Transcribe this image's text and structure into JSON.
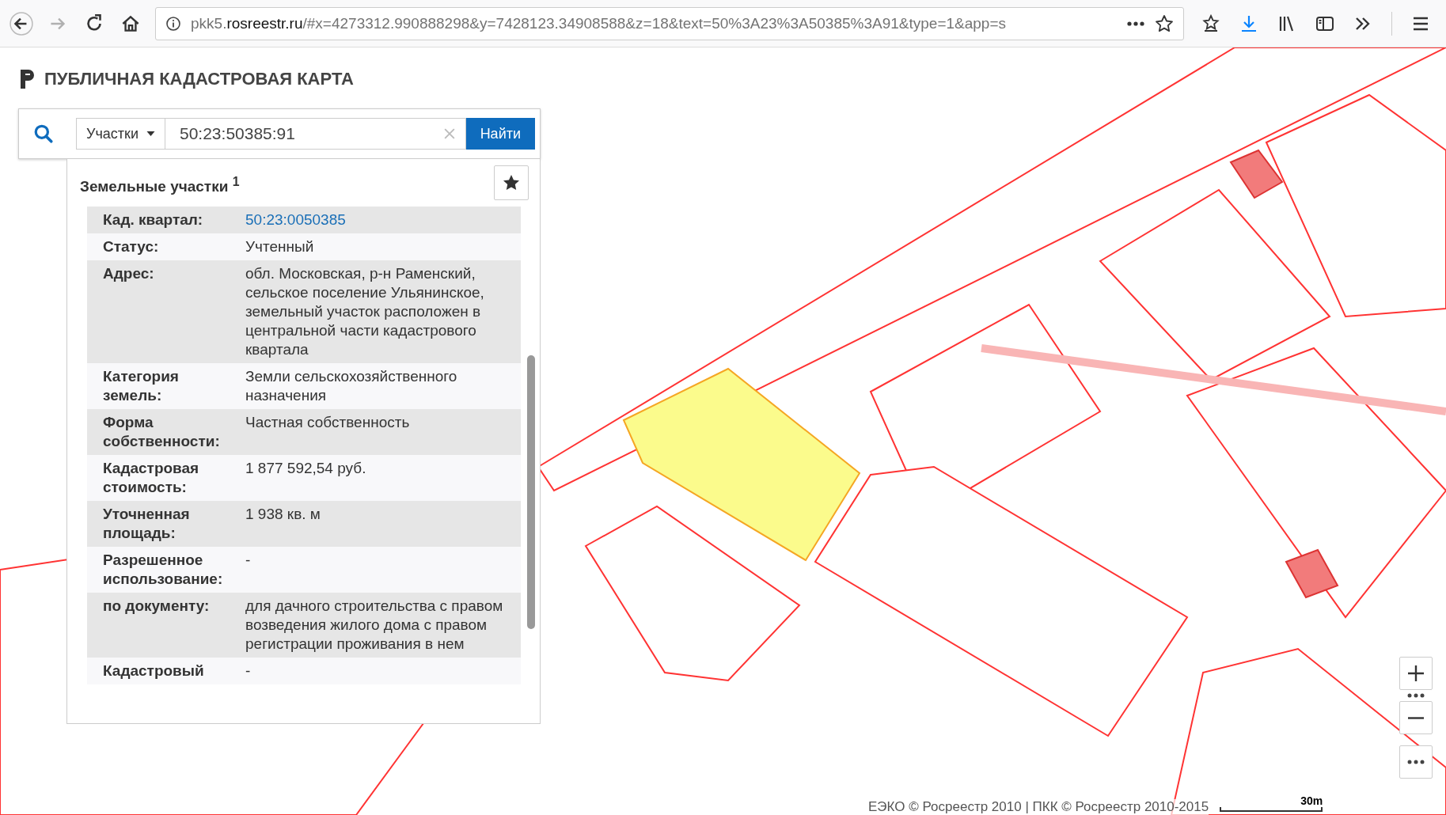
{
  "browser": {
    "nav": [
      {
        "kind": "back",
        "disabled": false
      },
      {
        "kind": "forward",
        "disabled": true
      },
      {
        "kind": "reload",
        "disabled": false
      },
      {
        "kind": "home",
        "disabled": false
      }
    ],
    "url": {
      "prefix": "pkk5.",
      "domain": "rosreestr.ru",
      "rest": "/#x=4273312.990888298&y=7428123.34908588&z=18&text=50%3A23%3A50385%3A91&type=1&app=s"
    }
  },
  "app": {
    "title": "ПУБЛИЧНАЯ КАДАСТРОВАЯ КАРТА"
  },
  "search": {
    "category": "Участки",
    "value": "50:23:50385:91",
    "button": "Найти"
  },
  "results": {
    "heading": "Земельные участки",
    "count": "1",
    "rows": [
      {
        "label": "Кад. квартал:",
        "value": "50:23:0050385",
        "kind": "link"
      },
      {
        "label": "Статус:",
        "value": "Учтенный",
        "kind": "text"
      },
      {
        "label": "Адрес:",
        "value": "обл. Московская, р-н Раменский, сельское поселение Ульянинское, земельный участок расположен в центральной части кадастрового квартала",
        "kind": "text"
      },
      {
        "label": "Категория земель:",
        "value": "Земли сельскохозяйственного назначения",
        "kind": "text"
      },
      {
        "label": "Форма собственности:",
        "value": "Частная собственность",
        "kind": "text"
      },
      {
        "label": "Кадастровая стоимость:",
        "value": "1 877 592,54 руб.",
        "kind": "text"
      },
      {
        "label": "Уточненная площадь:",
        "value": "1 938 кв. м",
        "kind": "text"
      },
      {
        "label": "Разрешенное использование:",
        "value": "-",
        "kind": "text"
      },
      {
        "label": "по документу:",
        "value": "для дачного строительства с правом возведения жилого дома с правом регистрации проживания в нем",
        "kind": "text"
      },
      {
        "label": "Кадастровый",
        "value": "-",
        "kind": "text"
      }
    ]
  },
  "map": {
    "attribution": "ЕЭКО © Росреестр 2010 | ПКК © Росреестр 2010-2015",
    "scale": "30m"
  }
}
